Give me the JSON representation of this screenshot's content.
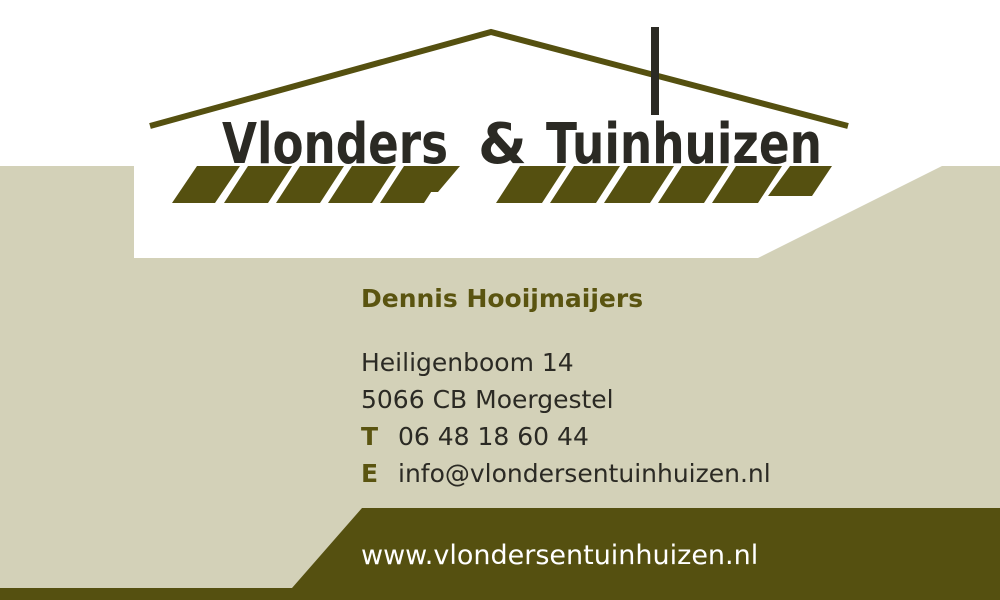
{
  "brand": {
    "name_part1": "Vlonders",
    "ampersand": "&",
    "name_part2": "Tuinhuizen"
  },
  "contact": {
    "name": "Dennis Hooijmaijers",
    "street": "Heiligenboom 14",
    "city": "5066 CB Moergestel",
    "phone_label": "T",
    "phone": "06 48 18 60 44",
    "email_label": "E",
    "email": "info@vlondersentuinhuizen.nl"
  },
  "footer": {
    "website": "www.vlondersentuinhuizen.nl"
  },
  "colors": {
    "olive": "#555010",
    "beige": "#d3d1b8",
    "text": "#2b2a24",
    "white": "#ffffff"
  },
  "icons": {
    "logo": "house-roof-with-deck-planks"
  }
}
